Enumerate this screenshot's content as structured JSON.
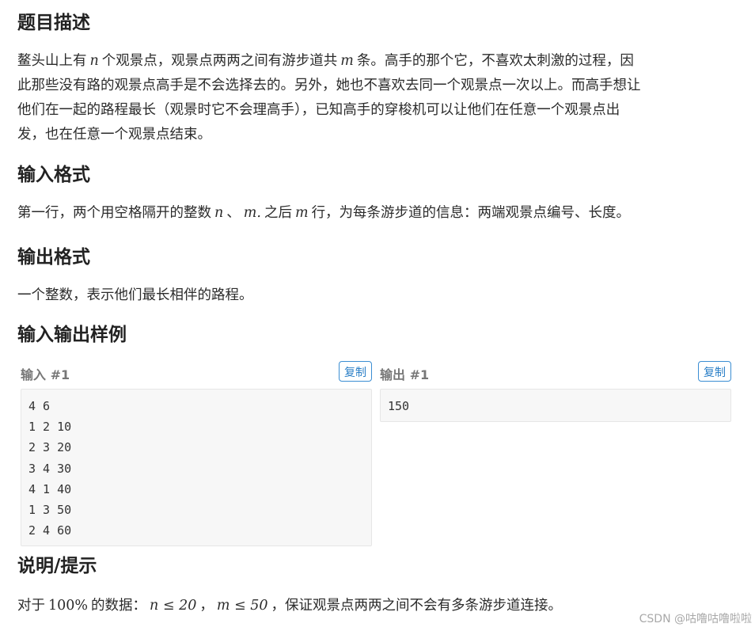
{
  "description": {
    "title": "题目描述",
    "lines": [
      [
        "鳌头山上有",
        "n",
        "个观景点，观景点两两之间有游步道共",
        "m",
        "条。高手的那个它，不喜欢太刺激的过程，因"
      ],
      [
        "此那些没有路的观景点高手是不会选择去的。另外，她也不喜欢去同一个观景点一次以上。而高手想让"
      ],
      [
        "他们在一起的路程最长（观景时它不会理高手），已知高手的穿梭机可以让他们在任意一个观景点出"
      ],
      [
        "发，也在任意一个观景点结束。"
      ]
    ]
  },
  "input_format": {
    "title": "输入格式",
    "parts": [
      "第一行，两个用空格隔开的整数",
      "n",
      "、",
      "m.",
      "之后",
      "m",
      "行，为每条游步道的信息：两端观景点编号、长度。"
    ]
  },
  "output_format": {
    "title": "输出格式",
    "text": "一个整数，表示他们最长相伴的路程。"
  },
  "samples": {
    "title": "输入输出样例",
    "input": {
      "label": "输入 #1",
      "copy_label": "复制",
      "lines": [
        "4 6",
        "1 2 10",
        "2 3 20",
        "3 4 30",
        "4 1 40",
        "1 3 50",
        "2 4 60"
      ]
    },
    "output": {
      "label": "输出 #1",
      "copy_label": "复制",
      "lines": [
        "150"
      ]
    }
  },
  "hint": {
    "title": "说明/提示",
    "parts": [
      "对于",
      "100%",
      "的数据：",
      "n ≤ 20",
      "，",
      "m ≤ 50",
      "，保证观景点两两之间不会有多条游步道连接。"
    ]
  },
  "watermark": "CSDN @咕噜咕噜啦啦"
}
